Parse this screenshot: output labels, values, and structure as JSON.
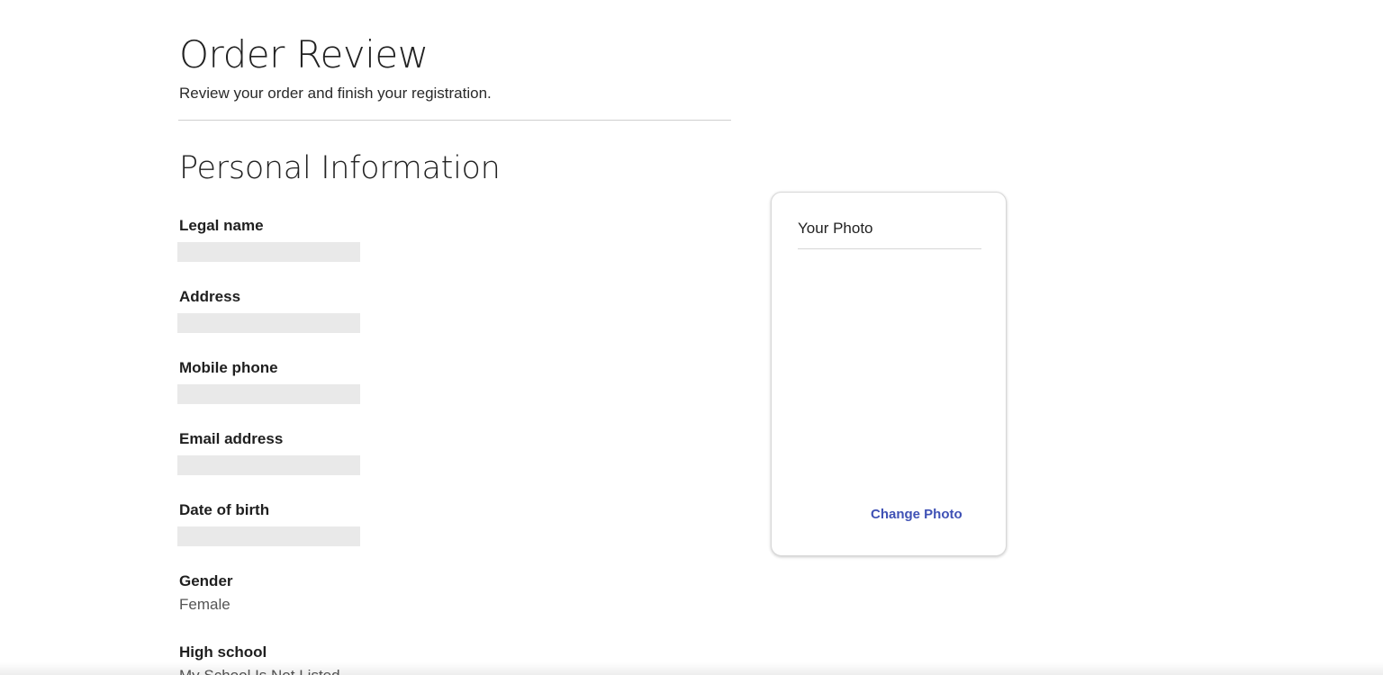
{
  "header": {
    "title": "Order Review",
    "subtitle": "Review your order and finish your registration."
  },
  "personal_info": {
    "section_title": "Personal Information",
    "fields": [
      {
        "label": "Legal name",
        "value": ""
      },
      {
        "label": "Address",
        "value": ""
      },
      {
        "label": "Mobile phone",
        "value": ""
      },
      {
        "label": "Email address",
        "value": ""
      },
      {
        "label": "Date of birth",
        "value": ""
      },
      {
        "label": "Gender",
        "value": "Female"
      },
      {
        "label": "High school",
        "value": "My School Is Not Listed"
      }
    ]
  },
  "photo_card": {
    "title": "Your Photo",
    "change_label": "Change Photo"
  },
  "colors": {
    "link_accent": "#3f51b5",
    "placeholder_bar": "#e9e9e9",
    "divider": "#cfcfcf"
  }
}
